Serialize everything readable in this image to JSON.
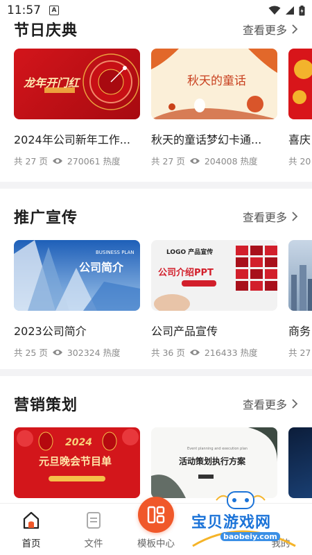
{
  "status_bar": {
    "time": "11:57"
  },
  "sections": [
    {
      "title": "节日庆典",
      "more_label": "查看更多",
      "cards": [
        {
          "title": "2024年公司新年工作...",
          "pages": "共 27 页",
          "heat": "270061 热度",
          "thumb_text": "龙年开门红"
        },
        {
          "title": "秋天的童话梦幻卡通...",
          "pages": "共 27 页",
          "heat": "204008 热度",
          "thumb_text": "秋天的童话"
        },
        {
          "title": "喜庆",
          "pages": "共 20",
          "heat": ""
        }
      ]
    },
    {
      "title": "推广宣传",
      "more_label": "查看更多",
      "cards": [
        {
          "title": "2023公司简介",
          "pages": "共 25 页",
          "heat": "302324 热度",
          "thumb_text": "公司简介",
          "thumb_sub": "BUSINESS PLAN"
        },
        {
          "title": "公司产品宣传",
          "pages": "共 36 页",
          "heat": "216433 热度",
          "thumb_text": "公司介绍PPT",
          "thumb_sub": "LOGO 产品宣传"
        },
        {
          "title": "商务",
          "pages": "共 27",
          "heat": ""
        }
      ]
    },
    {
      "title": "营销策划",
      "more_label": "查看更多",
      "cards": [
        {
          "title": "",
          "pages": "",
          "heat": "",
          "thumb_text": "元旦晚会节目单",
          "thumb_sub": "2024"
        },
        {
          "title": "",
          "pages": "",
          "heat": "",
          "thumb_text": "活动策划执行方案",
          "thumb_sub": "Event planning and execution plan"
        },
        {
          "title": "",
          "pages": "",
          "heat": ""
        }
      ]
    }
  ],
  "tabbar": {
    "items": [
      {
        "label": "首页",
        "icon": "home-icon",
        "active": true
      },
      {
        "label": "文件",
        "icon": "file-icon",
        "active": false
      },
      {
        "label": "模板中心",
        "icon": "template-icon",
        "active": false
      },
      {
        "label": "",
        "icon": "",
        "active": false
      },
      {
        "label": "我的",
        "icon": "profile-icon",
        "active": false
      }
    ]
  },
  "watermark": {
    "text": "宝贝游戏网",
    "url": "baobeiy.com"
  },
  "colors": {
    "accent": "#f0582a",
    "watermark_blue": "#1b73d8"
  }
}
